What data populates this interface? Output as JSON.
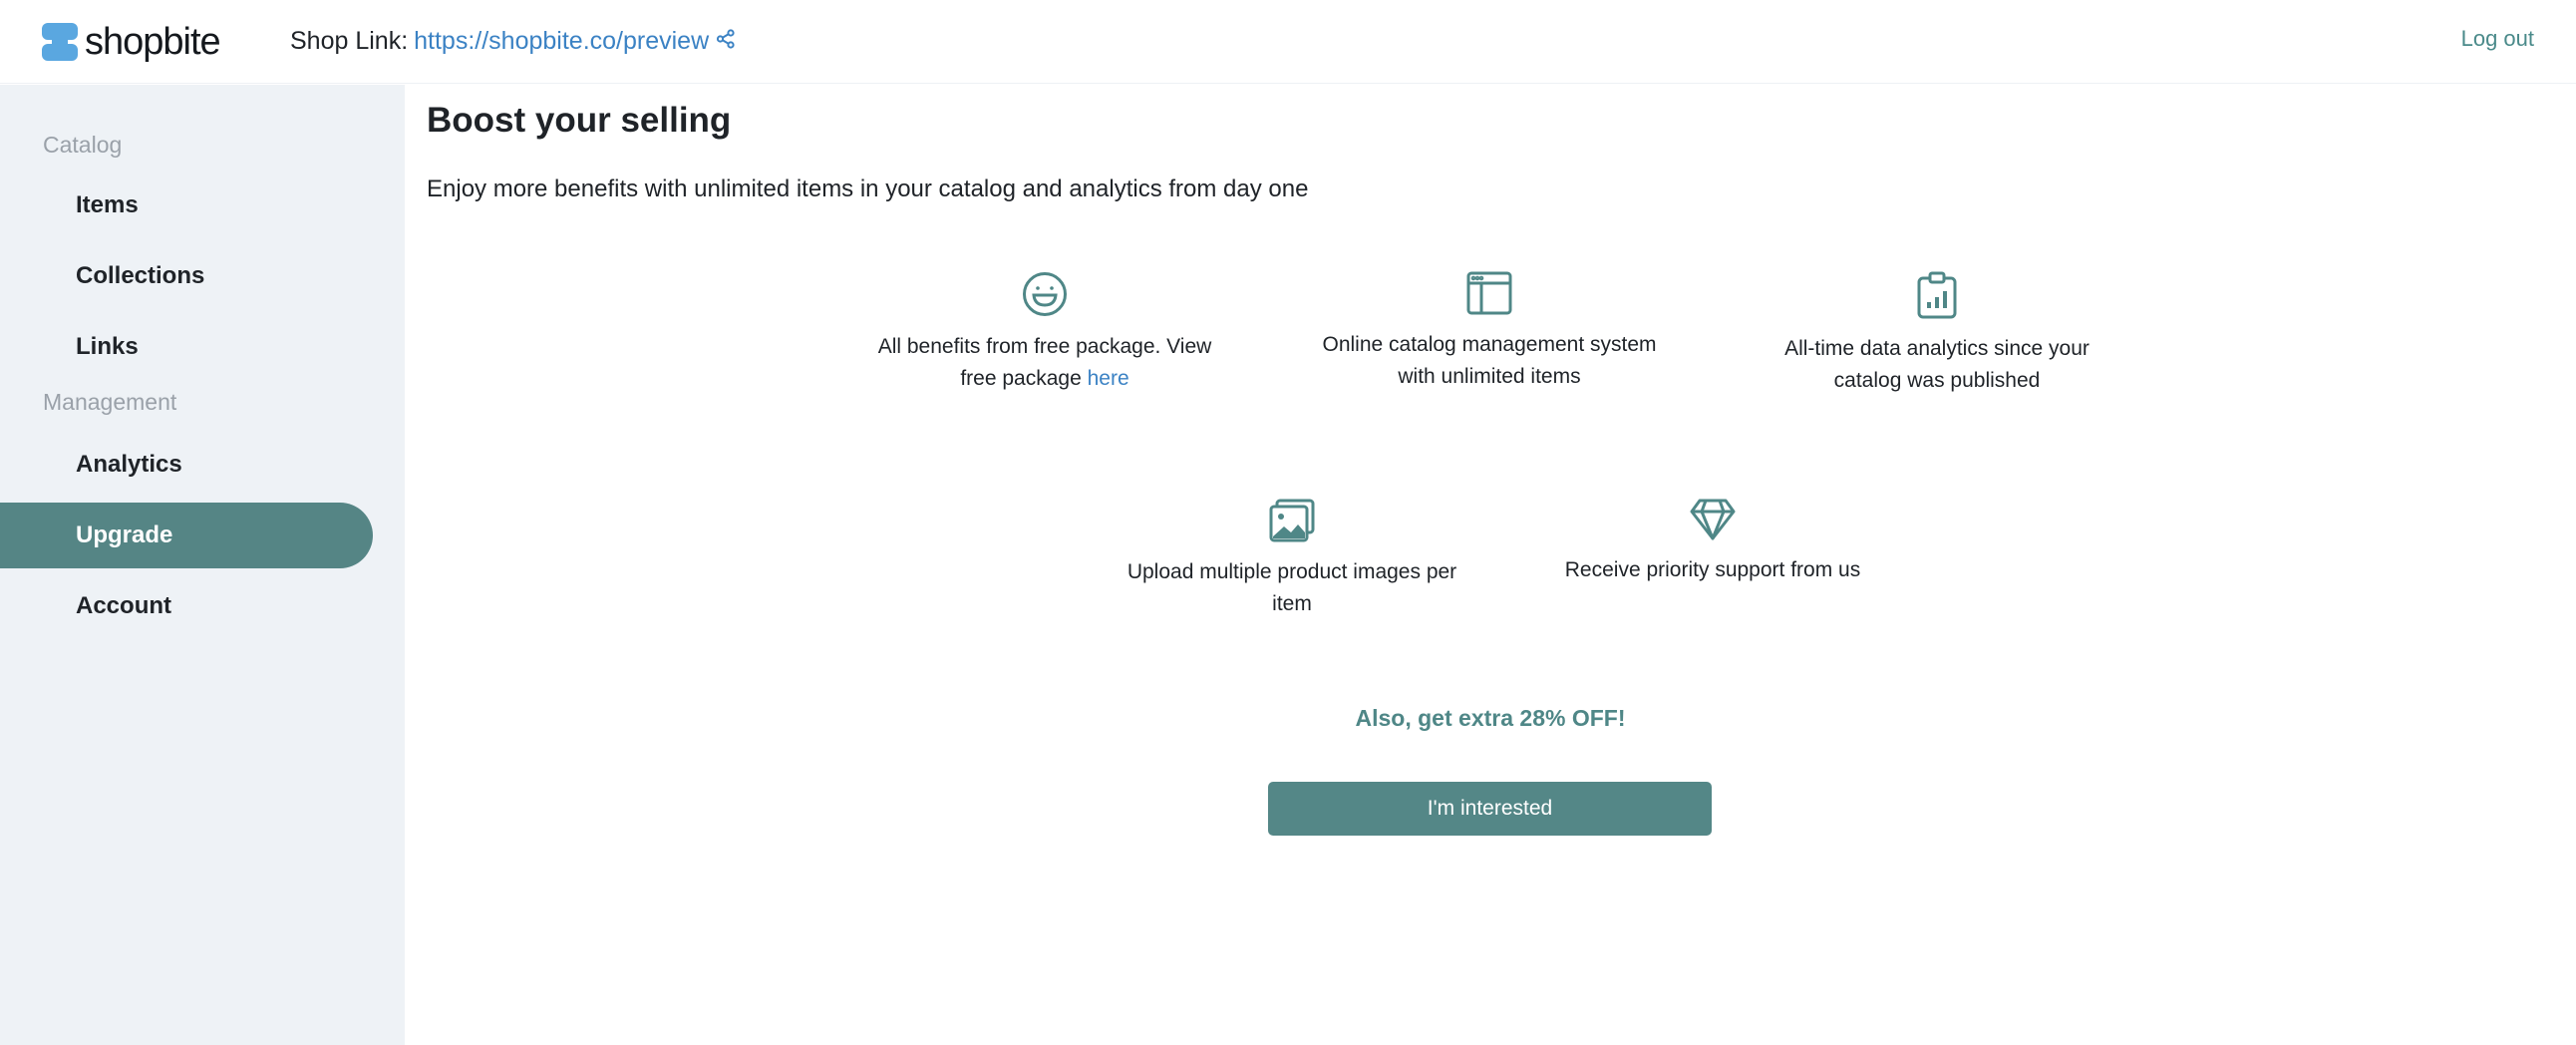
{
  "header": {
    "brand": "shopbite",
    "shop_link_label": "Shop Link:",
    "shop_link_url": "https://shopbite.co/preview",
    "logout_label": "Log out"
  },
  "sidebar": {
    "sections": [
      {
        "heading": "Catalog",
        "items": [
          {
            "label": "Items"
          },
          {
            "label": "Collections"
          },
          {
            "label": "Links"
          }
        ]
      },
      {
        "heading": "Management",
        "items": [
          {
            "label": "Analytics"
          },
          {
            "label": "Upgrade",
            "active": true
          },
          {
            "label": "Account"
          }
        ]
      }
    ]
  },
  "main": {
    "title": "Boost your selling",
    "subtitle": "Enjoy more benefits with unlimited items in your catalog and analytics from day one",
    "benefits": [
      {
        "icon": "smile-icon",
        "line1": "All benefits from free package. View",
        "line2": "free package",
        "link": "here"
      },
      {
        "icon": "browser-window-icon",
        "line1": "Online catalog management system",
        "line2": "with unlimited items"
      },
      {
        "icon": "clipboard-chart-icon",
        "line1": "All-time data analytics since your",
        "line2": "catalog was published"
      },
      {
        "icon": "images-icon",
        "line1": "Upload multiple product images per",
        "line2": "item"
      },
      {
        "icon": "diamond-icon",
        "line1": "Receive priority support from us"
      }
    ],
    "promo": "Also, get extra 28% OFF!",
    "cta_label": "I'm interested"
  },
  "colors": {
    "accent": "#558585",
    "link": "#3b82c4",
    "sidebar_bg": "#eef2f6",
    "logo": "#5aa7e0"
  }
}
